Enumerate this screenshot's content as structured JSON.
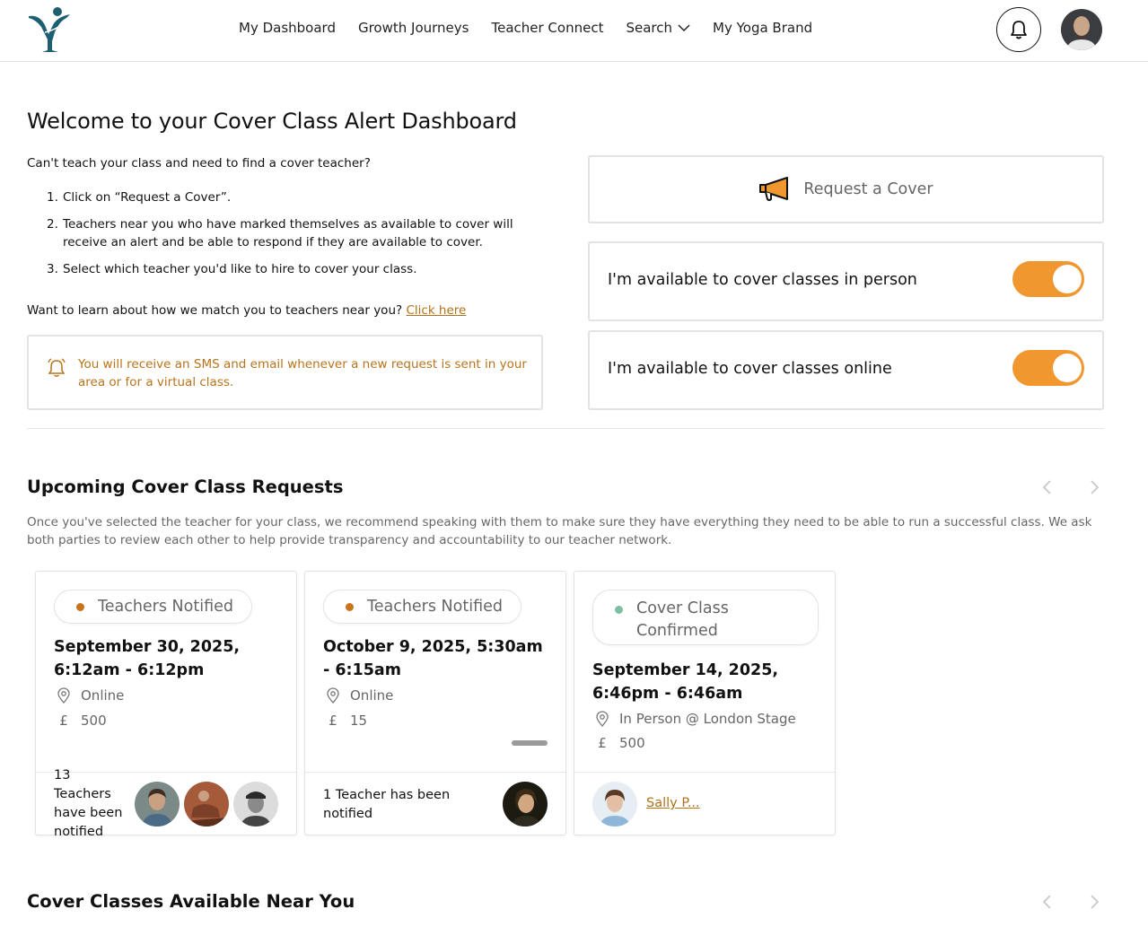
{
  "nav": {
    "items": [
      "My Dashboard",
      "Growth Journeys",
      "Teacher Connect",
      "Search",
      "My Yoga Brand"
    ]
  },
  "welcome": {
    "title": "Welcome to your Cover Class Alert Dashboard",
    "intro": "Can't teach your class and need to find a cover teacher?",
    "steps": [
      "Click on “Request a Cover”.",
      "Teachers near you who have marked themselves as available to cover will receive an alert and be able to respond if they are available to cover.",
      "Select which teacher you'd like to hire to cover your class."
    ],
    "learn_text": "Want to learn about how we match you to teachers near you?",
    "learn_link": "Click here",
    "notice": "You will receive an SMS and email whenever a new request is sent in your area or for a virtual class."
  },
  "actions": {
    "request_label": "Request a Cover",
    "toggle_in_person": "I'm available to cover classes in person",
    "toggle_online": "I'm available to cover classes online",
    "toggle_in_person_on": true,
    "toggle_online_on": true
  },
  "upcoming": {
    "title": "Upcoming Cover Class Requests",
    "description": "Once you've selected the teacher for your class, we recommend speaking with them to make sure they have everything they need to be able to run a successful class. We ask both parties to review each other to help provide transparency and accountability to our teacher network.",
    "cards": [
      {
        "status": "Teachers Notified",
        "status_color": "#c9731b",
        "date": "September 30, 2025, 6:12am - 6:12pm",
        "location": "Online",
        "currency": "£",
        "price": "500",
        "footer": "13 Teachers have been notified"
      },
      {
        "status": "Teachers Notified",
        "status_color": "#c9731b",
        "date": "October 9, 2025, 5:30am - 6:15am",
        "location": "Online",
        "currency": "£",
        "price": "15",
        "footer": "1 Teacher has been notified"
      },
      {
        "status": "Cover Class Confirmed",
        "status_color": "#7dbfa4",
        "date": "September 14, 2025, 6:46pm - 6:46am",
        "location": "In Person @ London Stage",
        "currency": "£",
        "price": "500",
        "footer": "Sally P..."
      }
    ]
  },
  "nearby": {
    "title": "Cover Classes Available Near You"
  },
  "colors": {
    "accent": "#f0982f",
    "link": "#b07219",
    "notice_text": "#b8731c"
  },
  "icons": [
    "logo-icon",
    "chevron-down-icon",
    "bell-icon",
    "megaphone-icon",
    "location-pin-icon",
    "pound-icon",
    "chevron-left-icon",
    "chevron-right-icon"
  ]
}
